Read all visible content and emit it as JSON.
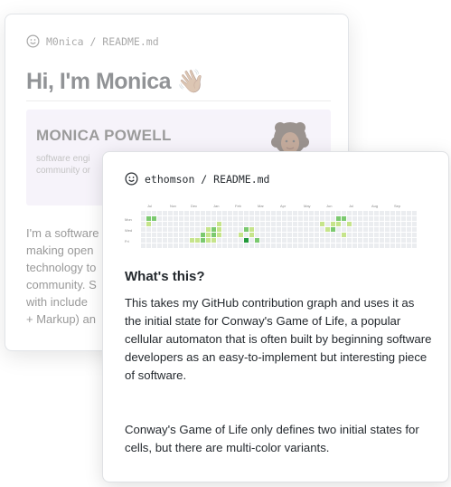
{
  "back_card": {
    "header": {
      "icon": "smiley-icon",
      "path": "M0nica / README.md"
    },
    "title": "Hi, I'm Monica",
    "title_emoji": "👋🏽",
    "banner": {
      "name": "MONICA POWELL",
      "subtitle_lines": [
        "software engi",
        "community or"
      ]
    },
    "body_lines": [
      "I'm a software",
      "making open",
      "technology to",
      "community. S",
      "with include",
      "+ Markup) an"
    ]
  },
  "front_card": {
    "header": {
      "icon": "smiley-icon",
      "path": "ethomson / README.md"
    },
    "graph": {
      "months": [
        "Jul",
        "Nov",
        "Dec",
        "Jan",
        "Feb",
        "Mar",
        "Apr",
        "May",
        "Jun",
        "Jul",
        "Aug",
        "Sep"
      ],
      "day_labels": [
        "Mon",
        "Wed",
        "Fri"
      ],
      "colors": {
        "empty": "#ebedf0",
        "l1": "#c6e48b",
        "l2": "#7bc96f",
        "l3": "#239a3b"
      }
    },
    "heading": "What's this?",
    "para1": "This takes my GitHub contribution graph and uses it as the initial state for Conway's Game of Life, a popular cellular automaton that is often built by beginning software developers as an easy-to-implement but interesting piece of software.",
    "para2": "Conway's Game of Life only defines two initial states for cells, but there are multi-color variants."
  }
}
